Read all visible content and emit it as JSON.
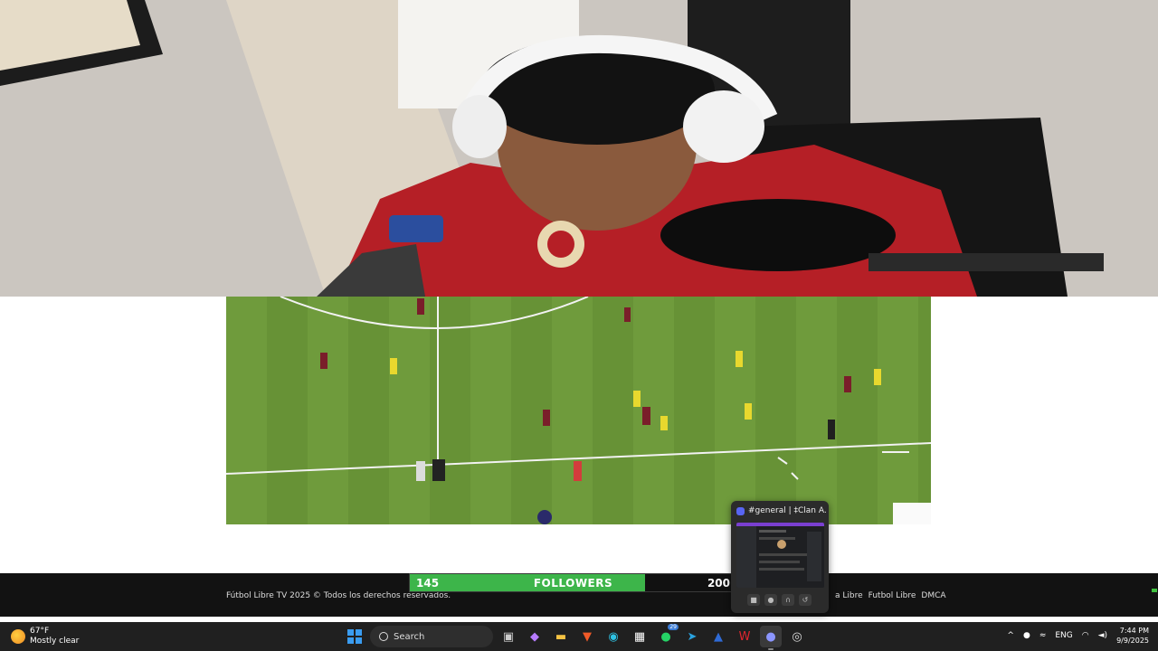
{
  "footer": {
    "copyright": "Fútbol Libre TV 2025 © Todos los derechos reservados.",
    "links": [
      "a Libre",
      "Futbol Libre",
      "DMCA"
    ]
  },
  "followers": {
    "current": "145",
    "label": "FOLLOWERS",
    "goal": "200",
    "progress": 0.725,
    "bar_color": "#3db54a"
  },
  "discord_preview": {
    "title": "#general | ‡Clan A...",
    "buttons": [
      "camera-icon",
      "mic-icon",
      "headset-icon",
      "hangup-icon"
    ]
  },
  "taskbar": {
    "weather_temp": "67°F",
    "weather_desc": "Mostly clear",
    "search_label": "Search",
    "apps": [
      "windows-start",
      "task-view",
      "copilot",
      "file-explorer",
      "brave",
      "edge",
      "microsoft-store",
      "whatsapp",
      "telegram",
      "mega",
      "wps-office",
      "discord",
      "obs"
    ],
    "whatsapp_badge": "29",
    "lang": "ENG",
    "time": "7:44 PM",
    "date": "9/9/2025"
  },
  "colors": {
    "pitch": "#6c9a3a",
    "taskbar": "#202020",
    "footer": "#121212"
  }
}
